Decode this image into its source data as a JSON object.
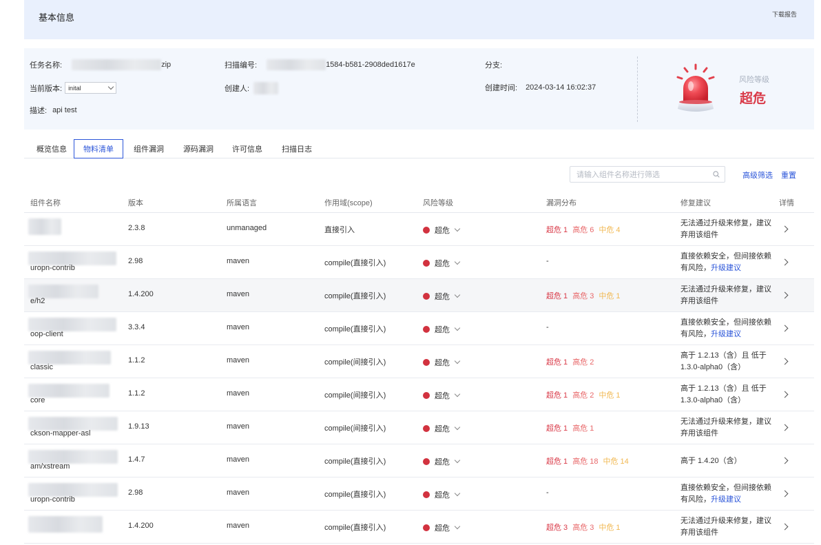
{
  "header": {
    "title": "基本信息",
    "download": "下载报告"
  },
  "info": {
    "task_label": "任务名称:",
    "task_value": "zip",
    "scan_label": "扫描编号:",
    "scan_value": "1584-b581-2908ded1617e",
    "branch_label": "分支:",
    "version_label": "当前版本:",
    "version_value": "inital",
    "creator_label": "创建人:",
    "created_time_label": "创建时间:",
    "created_time_value": "2024-03-14 16:02:37",
    "desc_label": "描述:",
    "desc_value": "api test",
    "risk_level_label": "风险等级",
    "risk_level_value": "超危"
  },
  "tabs": [
    "概览信息",
    "物料清单",
    "组件漏洞",
    "源码漏洞",
    "许可信息",
    "扫描日志"
  ],
  "active_tab": 1,
  "search": {
    "placeholder": "请输入组件名称进行筛选"
  },
  "actions": {
    "advanced_filter": "高级筛选",
    "reset": "重置"
  },
  "table": {
    "columns": [
      "组件名称",
      "版本",
      "所属语言",
      "作用域(scope)",
      "风险等级",
      "漏洞分布",
      "修复建议",
      "详情"
    ],
    "rows": [
      {
        "name": "",
        "version": "2.3.8",
        "language": "unmanaged",
        "scope": "直接引入",
        "risk": "超危",
        "vuln": [
          "超危 1",
          "高危 6",
          "中危 4"
        ],
        "fix": "无法通过升级来修复，建议弃用该组件",
        "fix_link": ""
      },
      {
        "name": "uropn-contrib",
        "version": "2.98",
        "language": "maven",
        "scope": "compile(直接引入)",
        "risk": "超危",
        "vuln": [
          "-"
        ],
        "fix": "直接依赖安全，但间接依赖有风险，",
        "fix_link": "升级建议"
      },
      {
        "name": "e/h2",
        "version": "1.4.200",
        "language": "maven",
        "scope": "compile(直接引入)",
        "risk": "超危",
        "vuln": [
          "超危 1",
          "高危 3",
          "中危 1"
        ],
        "fix": "无法通过升级来修复，建议弃用该组件",
        "fix_link": ""
      },
      {
        "name": "oop-client",
        "version": "3.3.4",
        "language": "maven",
        "scope": "compile(直接引入)",
        "risk": "超危",
        "vuln": [
          "-"
        ],
        "fix": "直接依赖安全，但间接依赖有风险，",
        "fix_link": "升级建议"
      },
      {
        "name": "classic",
        "version": "1.1.2",
        "language": "maven",
        "scope": "compile(间接引入)",
        "risk": "超危",
        "vuln": [
          "超危 1",
          "高危 2"
        ],
        "fix": "高于 1.2.13（含）且 低于 1.3.0-alpha0（含）",
        "fix_link": ""
      },
      {
        "name": "core",
        "version": "1.1.2",
        "language": "maven",
        "scope": "compile(间接引入)",
        "risk": "超危",
        "vuln": [
          "超危 1",
          "高危 2",
          "中危 1"
        ],
        "fix": "高于 1.2.13（含）且 低于 1.3.0-alpha0（含）",
        "fix_link": ""
      },
      {
        "name": "ckson-mapper-asl",
        "version": "1.9.13",
        "language": "maven",
        "scope": "compile(间接引入)",
        "risk": "超危",
        "vuln": [
          "超危 1",
          "高危 1"
        ],
        "fix": "无法通过升级来修复，建议弃用该组件",
        "fix_link": ""
      },
      {
        "name": "am/xstream",
        "version": "1.4.7",
        "language": "maven",
        "scope": "compile(直接引入)",
        "risk": "超危",
        "vuln": [
          "超危 1",
          "高危 18",
          "中危 14"
        ],
        "fix": "高于 1.4.20（含）",
        "fix_link": ""
      },
      {
        "name": "uropn-contrib",
        "version": "2.98",
        "language": "maven",
        "scope": "compile(直接引入)",
        "risk": "超危",
        "vuln": [
          "-"
        ],
        "fix": "直接依赖安全，但间接依赖有风险，",
        "fix_link": "升级建议"
      },
      {
        "name": "",
        "version": "1.4.200",
        "language": "maven",
        "scope": "compile(直接引入)",
        "risk": "超危",
        "vuln": [
          "超危 3",
          "高危 3",
          "中危 1"
        ],
        "fix": "无法通过升级来修复，建议弃用该组件",
        "fix_link": ""
      }
    ]
  },
  "colors": {
    "accent": "#2b55d9",
    "critical": "#d93a48",
    "high": "#e8686a",
    "medium": "#f1b852"
  }
}
